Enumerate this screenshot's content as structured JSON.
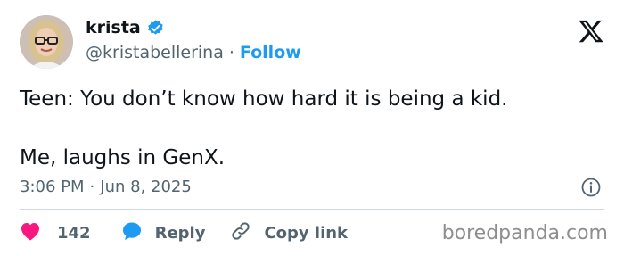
{
  "author": {
    "display_name": "krista",
    "handle": "@kristabellerina",
    "separator": "·",
    "follow_label": "Follow"
  },
  "tweet": {
    "lines": [
      "Teen: You don’t know how hard it is being a kid.",
      "Me, laughs in GenX."
    ],
    "time": "3:06 PM",
    "separator": "·",
    "date": "Jun 8, 2025"
  },
  "actions": {
    "like_count": "142",
    "reply_label": "Reply",
    "copy_label": "Copy link"
  },
  "watermark": "boredpanda.com",
  "icons": {
    "verified": "verified-badge-icon",
    "x_logo": "x-logo-icon",
    "info": "info-icon",
    "heart": "heart-icon",
    "reply": "reply-bubble-icon",
    "link": "link-icon"
  },
  "colors": {
    "accent": "#1d9bf0",
    "like": "#f91880",
    "secondary_text": "#536471",
    "primary_text": "#0f1419"
  }
}
